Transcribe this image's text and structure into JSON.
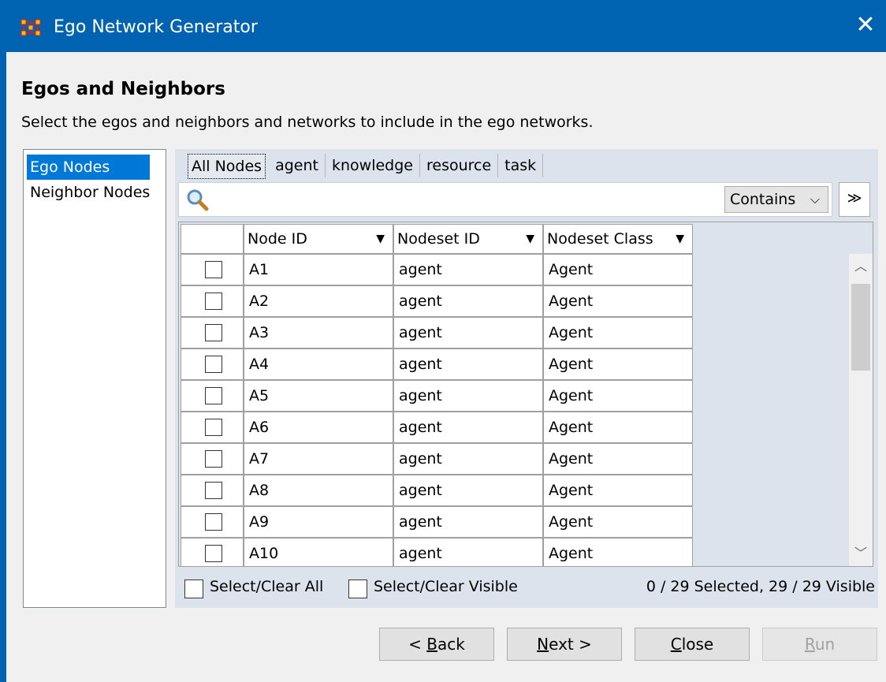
{
  "window": {
    "title": "Ego Network Generator",
    "close_glyph": "✕"
  },
  "page": {
    "heading": "Egos and Neighbors",
    "subheading": "Select the egos and neighbors and networks to include in the ego networks."
  },
  "sidebar": {
    "items": [
      {
        "label": "Ego Nodes",
        "selected": true
      },
      {
        "label": "Neighbor Nodes",
        "selected": false
      }
    ]
  },
  "tabs": [
    {
      "label": "All Nodes",
      "active": true
    },
    {
      "label": "agent"
    },
    {
      "label": "knowledge"
    },
    {
      "label": "resource"
    },
    {
      "label": "task"
    }
  ],
  "search": {
    "value": "",
    "mode": "Contains",
    "expand_glyph": "≫"
  },
  "table": {
    "columns": [
      "Node ID",
      "Nodeset ID",
      "Nodeset Class"
    ],
    "rows": [
      {
        "node_id": "A1",
        "nodeset_id": "agent",
        "nodeset_class": "Agent",
        "checked": false
      },
      {
        "node_id": "A2",
        "nodeset_id": "agent",
        "nodeset_class": "Agent",
        "checked": false
      },
      {
        "node_id": "A3",
        "nodeset_id": "agent",
        "nodeset_class": "Agent",
        "checked": false
      },
      {
        "node_id": "A4",
        "nodeset_id": "agent",
        "nodeset_class": "Agent",
        "checked": false
      },
      {
        "node_id": "A5",
        "nodeset_id": "agent",
        "nodeset_class": "Agent",
        "checked": false
      },
      {
        "node_id": "A6",
        "nodeset_id": "agent",
        "nodeset_class": "Agent",
        "checked": false
      },
      {
        "node_id": "A7",
        "nodeset_id": "agent",
        "nodeset_class": "Agent",
        "checked": false
      },
      {
        "node_id": "A8",
        "nodeset_id": "agent",
        "nodeset_class": "Agent",
        "checked": false
      },
      {
        "node_id": "A9",
        "nodeset_id": "agent",
        "nodeset_class": "Agent",
        "checked": false
      },
      {
        "node_id": "A10",
        "nodeset_id": "agent",
        "nodeset_class": "Agent",
        "checked": false
      }
    ]
  },
  "footer": {
    "select_all_label": "Select/Clear All",
    "select_visible_label": "Select/Clear Visible",
    "status": "0 / 29 Selected, 29 / 29 Visible"
  },
  "buttons": {
    "back": {
      "pre": "< ",
      "mnemonic": "B",
      "post": "ack"
    },
    "next": {
      "pre": "",
      "mnemonic": "N",
      "post": "ext >"
    },
    "close": {
      "pre": "",
      "mnemonic": "C",
      "post": "lose"
    },
    "run": {
      "pre": "",
      "mnemonic": "R",
      "post": "un",
      "disabled": true
    }
  },
  "colors": {
    "titlebar": "#0063b1",
    "selection": "#0078d7",
    "panel": "#dce3ed"
  }
}
